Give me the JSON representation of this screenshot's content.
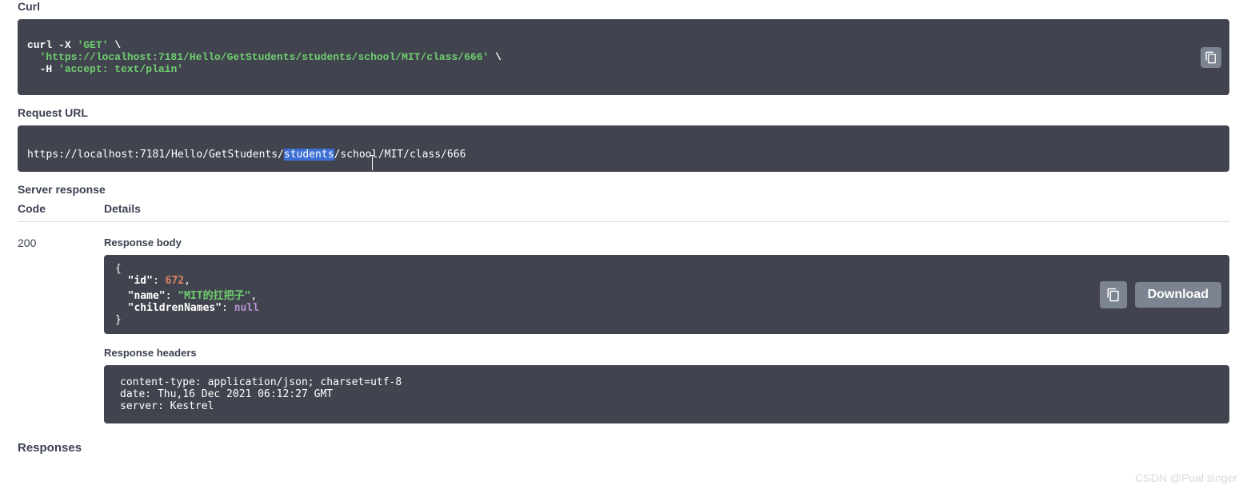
{
  "sections": {
    "curl_label": "Curl",
    "request_url_label": "Request URL",
    "server_response_label": "Server response",
    "code_header": "Code",
    "details_header": "Details",
    "response_body_label": "Response body",
    "response_headers_label": "Response headers",
    "responses_label": "Responses"
  },
  "curl": {
    "cmd": "curl",
    "flag_x": "-X",
    "method": "'GET'",
    "backslash1": " \\",
    "url": "'https://localhost:7181/Hello/GetStudents/students/school/MIT/class/666'",
    "backslash2": " \\",
    "flag_h": "-H",
    "accept": "'accept: text/plain'"
  },
  "request_url": {
    "pre": "https://localhost:7181/Hello/GetStudents/",
    "highlight": "students",
    "post1": "/schoo",
    "post2": "/MIT/class/666"
  },
  "response": {
    "code": "200",
    "body": {
      "id_key": "\"id\"",
      "id_val": "672",
      "name_key": "\"name\"",
      "name_val": "\"MIT的扛把子\"",
      "children_key": "\"childrenNames\"",
      "children_val": "null"
    },
    "headers_text": "content-type: application/json; charset=utf-8 \ndate: Thu,16 Dec 2021 06:12:27 GMT \nserver: Kestrel "
  },
  "buttons": {
    "download": "Download"
  },
  "watermark": "CSDN @Pual singer"
}
